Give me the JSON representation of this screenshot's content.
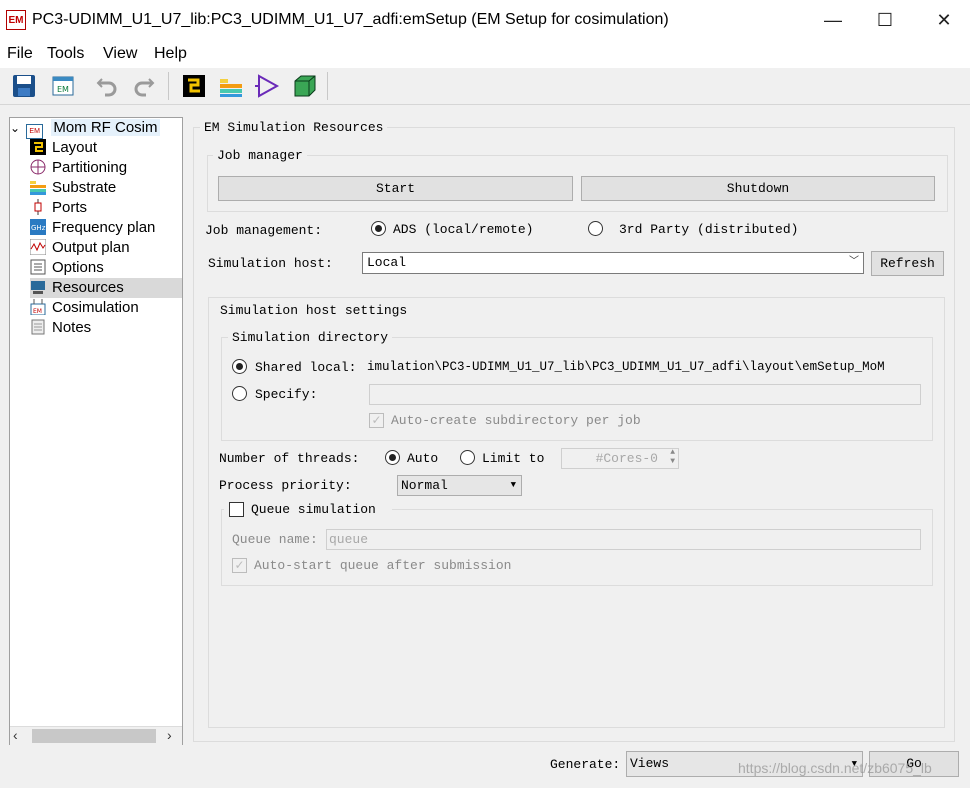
{
  "window": {
    "app_icon_text": "EM",
    "title": "PC3-UDIMM_U1_U7_lib:PC3_UDIMM_U1_U7_adfi:emSetup (EM Setup for cosimulation)",
    "minimize": "—",
    "maximize": "☐",
    "close": "✕"
  },
  "menu": [
    "File",
    "Tools",
    "View",
    "Help"
  ],
  "toolbar": {
    "icons": [
      "save-icon",
      "em-window-icon",
      "undo-icon",
      "redo-icon",
      "layout-icon",
      "substrate-icon",
      "simulate-icon",
      "3d-view-icon"
    ]
  },
  "tree": {
    "root_label": "Mom RF Cosim",
    "items": [
      {
        "label": "Layout",
        "icon": "layout-icon"
      },
      {
        "label": "Partitioning",
        "icon": "partitioning-icon"
      },
      {
        "label": "Substrate",
        "icon": "substrate-icon"
      },
      {
        "label": "Ports",
        "icon": "ports-icon"
      },
      {
        "label": "Frequency plan",
        "icon": "frequency-icon"
      },
      {
        "label": "Output plan",
        "icon": "output-plan-icon"
      },
      {
        "label": "Options",
        "icon": "options-icon"
      },
      {
        "label": "Resources",
        "icon": "resources-icon"
      },
      {
        "label": "Cosimulation",
        "icon": "cosimulation-icon"
      },
      {
        "label": "Notes",
        "icon": "notes-icon"
      }
    ],
    "selected": "Resources"
  },
  "resources": {
    "section_title": "EM Simulation Resources",
    "job_manager": {
      "title": "Job manager",
      "start_label": "Start",
      "shutdown_label": "Shutdown"
    },
    "job_management": {
      "label": "Job management:",
      "option_ads": "ADS (local/remote)",
      "option_third_party": "3rd Party (distributed)",
      "selected": "ADS (local/remote)"
    },
    "simulation_host": {
      "label": "Simulation host:",
      "value": "Local",
      "refresh_label": "Refresh"
    },
    "host_settings": {
      "title": "Simulation host settings",
      "directory": {
        "title": "Simulation directory",
        "shared_local_label": "Shared local:",
        "shared_local_path": "imulation\\PC3-UDIMM_U1_U7_lib\\PC3_UDIMM_U1_U7_adfi\\layout\\emSetup_MoM",
        "specify_label": "Specify:",
        "specify_value": "",
        "auto_create_label": "Auto-create subdirectory per job"
      },
      "threads": {
        "label": "Number of threads:",
        "auto_label": "Auto",
        "limit_label": "Limit to",
        "limit_value": "#Cores-0"
      },
      "priority": {
        "label": "Process priority:",
        "value": "Normal"
      },
      "queue": {
        "label": "Queue simulation",
        "name_label": "Queue name:",
        "name_placeholder": "queue",
        "auto_start_label": "Auto-start queue after submission"
      }
    }
  },
  "footer": {
    "generate_label": "Generate:",
    "generate_value": "Views",
    "go_label": "Go"
  },
  "watermark": "https://blog.csdn.net/zb6075_lb"
}
